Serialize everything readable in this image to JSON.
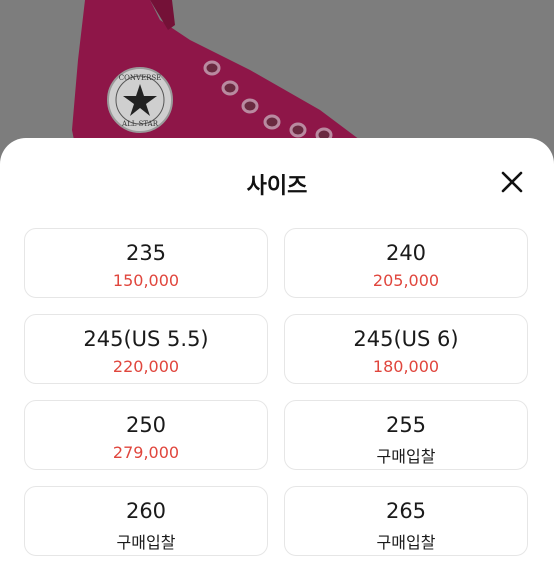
{
  "sheet": {
    "title": "사이즈",
    "close_icon": "close-icon"
  },
  "backdrop": {
    "logo_text_top": "CONVERSE",
    "logo_text_bottom": "ALL STAR",
    "shoe_color": "#b01a5a"
  },
  "colors": {
    "price": "#e0463d",
    "text": "#1a1a1a",
    "border": "#e6e6e6"
  },
  "sizes": [
    {
      "label": "235",
      "price": "150,000",
      "status": ""
    },
    {
      "label": "240",
      "price": "205,000",
      "status": ""
    },
    {
      "label": "245(US 5.5)",
      "price": "220,000",
      "status": ""
    },
    {
      "label": "245(US 6)",
      "price": "180,000",
      "status": ""
    },
    {
      "label": "250",
      "price": "279,000",
      "status": ""
    },
    {
      "label": "255",
      "price": "",
      "status": "구매입찰"
    },
    {
      "label": "260",
      "price": "",
      "status": "구매입찰"
    },
    {
      "label": "265",
      "price": "",
      "status": "구매입찰"
    }
  ]
}
